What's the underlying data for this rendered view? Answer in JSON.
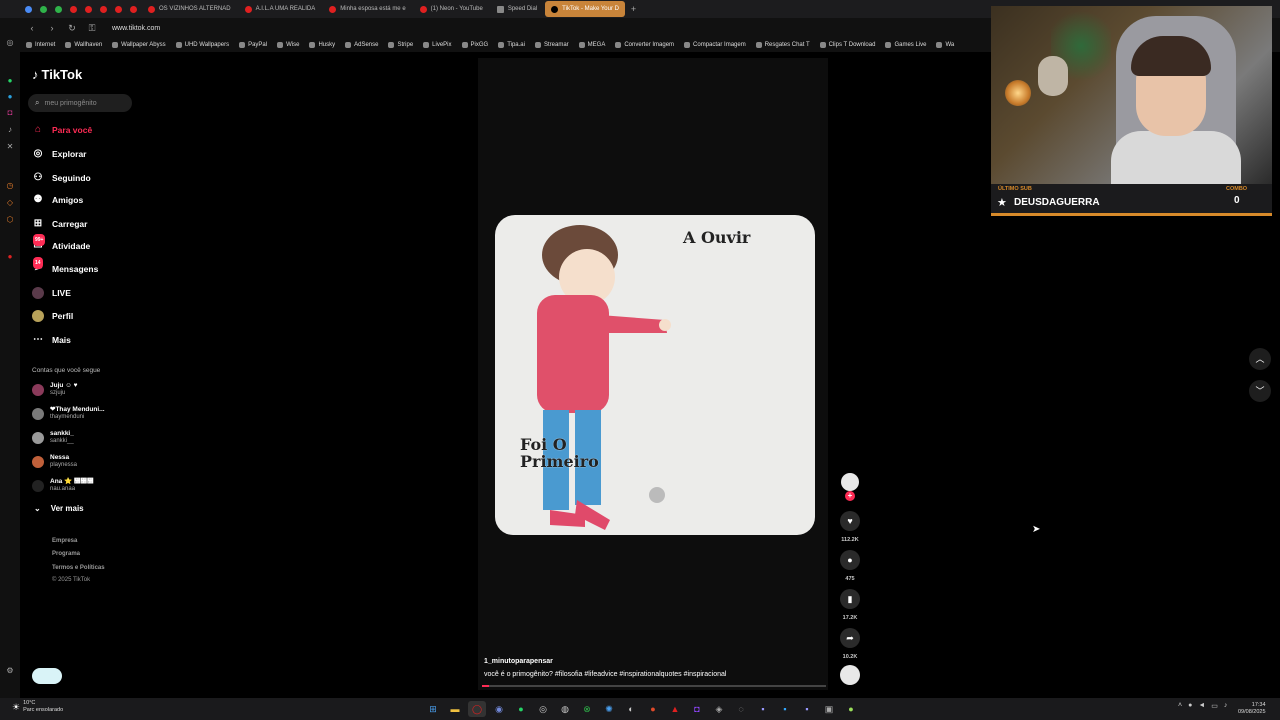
{
  "browser": {
    "url": "www.tiktok.com",
    "tabs": [
      {
        "label": "OS VIZINHOS ALTERNAD"
      },
      {
        "label": "A.I.L.A UMA REALIDA"
      },
      {
        "label": "Minha esposa está me e"
      },
      {
        "label": "(1) Neon - YouTube"
      },
      {
        "label": "Speed Dial"
      },
      {
        "label": "TikTok - Make Your D",
        "active": true
      }
    ],
    "bookmarks": [
      "Internet",
      "Wallhaven",
      "Wallpaper Abyss",
      "UHD Wallpapers",
      "PayPal",
      "Wise",
      "Husky",
      "AdSense",
      "Stripe",
      "LivePix",
      "PixGG",
      "Tipa.ai",
      "Streamar",
      "MEGA",
      "Converter Imagem",
      "Compactar Imagem",
      "Resgates Chat T",
      "Clips T Download",
      "Games Live",
      "Wa"
    ]
  },
  "sidebar": {
    "logo": "TikTok",
    "search_placeholder": "meu primogênito",
    "nav": [
      {
        "label": "Para você",
        "icon": "home-icon",
        "active": true
      },
      {
        "label": "Explorar",
        "icon": "compass-icon"
      },
      {
        "label": "Seguindo",
        "icon": "user-follow-icon"
      },
      {
        "label": "Amigos",
        "icon": "friends-icon"
      },
      {
        "label": "Carregar",
        "icon": "upload-icon"
      },
      {
        "label": "Atividade",
        "icon": "activity-icon",
        "badge": "99+"
      },
      {
        "label": "Mensagens",
        "icon": "messages-icon",
        "badge": "14"
      },
      {
        "label": "LIVE",
        "icon": "live-icon"
      },
      {
        "label": "Perfil",
        "icon": "profile-icon"
      },
      {
        "label": "Mais",
        "icon": "more-icon"
      }
    ],
    "following_title": "Contas que você segue",
    "following": [
      {
        "name": "Juju ☺ ♥",
        "username": "szjuju"
      },
      {
        "name": "❤Thay Menduni...",
        "username": "thaymenduni"
      },
      {
        "name": "sankki_",
        "username": "sankki__"
      },
      {
        "name": "Nessa",
        "username": "playnessa"
      },
      {
        "name": "Ana ⭐ ᲼᲼᲼",
        "username": "nau.anaa"
      }
    ],
    "see_more": "Ver mais",
    "footer": [
      "Empresa",
      "Programa",
      "Termos e Políticas",
      "© 2025 TikTok"
    ]
  },
  "video": {
    "overlay_top": "A Ouvir",
    "overlay_bottom": "Foi O Primeiro",
    "author": "1_minutoparapensar",
    "caption": "você é o primogênito? #filosofia #lifeadvice #inspirationalquotes #inspiracional",
    "progress": 0.02,
    "likes": "112.2K",
    "comments": "475",
    "saves": "17.2K",
    "shares": "10.2K"
  },
  "overlay": {
    "sub_label": "ÚLTIMO SUB",
    "sub_name": "DEUSDAGUERRA",
    "combo_label": "COMBO",
    "combo_value": "0"
  },
  "taskbar": {
    "temp": "10°C",
    "weather": "Parc ensolarado",
    "time": "17:34",
    "date": "09/08/2025"
  }
}
